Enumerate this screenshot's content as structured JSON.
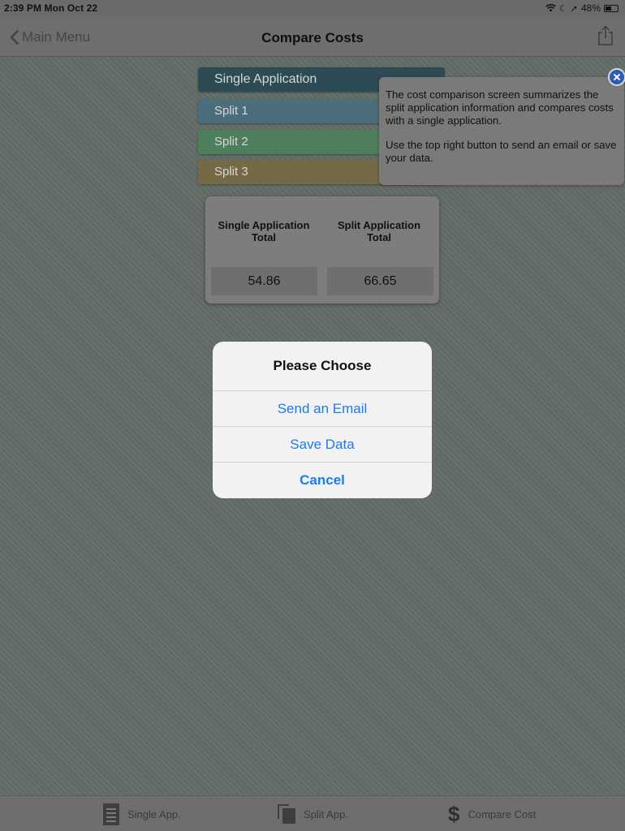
{
  "status_bar": {
    "time": "2:39 PM  Mon Oct 22",
    "battery": "48%",
    "battery_level": 0.48
  },
  "nav": {
    "back_label": "Main Menu",
    "title": "Compare Costs",
    "share_icon": "share-icon"
  },
  "segments": [
    {
      "label": "Single Application",
      "color": "#2d4b55"
    },
    {
      "label": "Split 1",
      "color": "#4c6d7b"
    },
    {
      "label": "Split 2",
      "color": "#4e7f5d"
    },
    {
      "label": "Split 3",
      "color": "#756a45"
    }
  ],
  "totals": {
    "single_header": "Single Application Total",
    "split_header": "Split Application Total",
    "single_value": "54.86",
    "split_value": "66.65"
  },
  "tooltip": {
    "line1": "The cost comparison screen summarizes the split application information and compares costs with a single application.",
    "line2": "Use the top right button to send an email or save your data."
  },
  "alert": {
    "title": "Please Choose",
    "email": "Send an Email",
    "save": "Save Data",
    "cancel": "Cancel",
    "accent": "#1d7bf0"
  },
  "tab_bar": {
    "single": "Single App.",
    "split": "Split App.",
    "compare": "Compare Cost"
  }
}
